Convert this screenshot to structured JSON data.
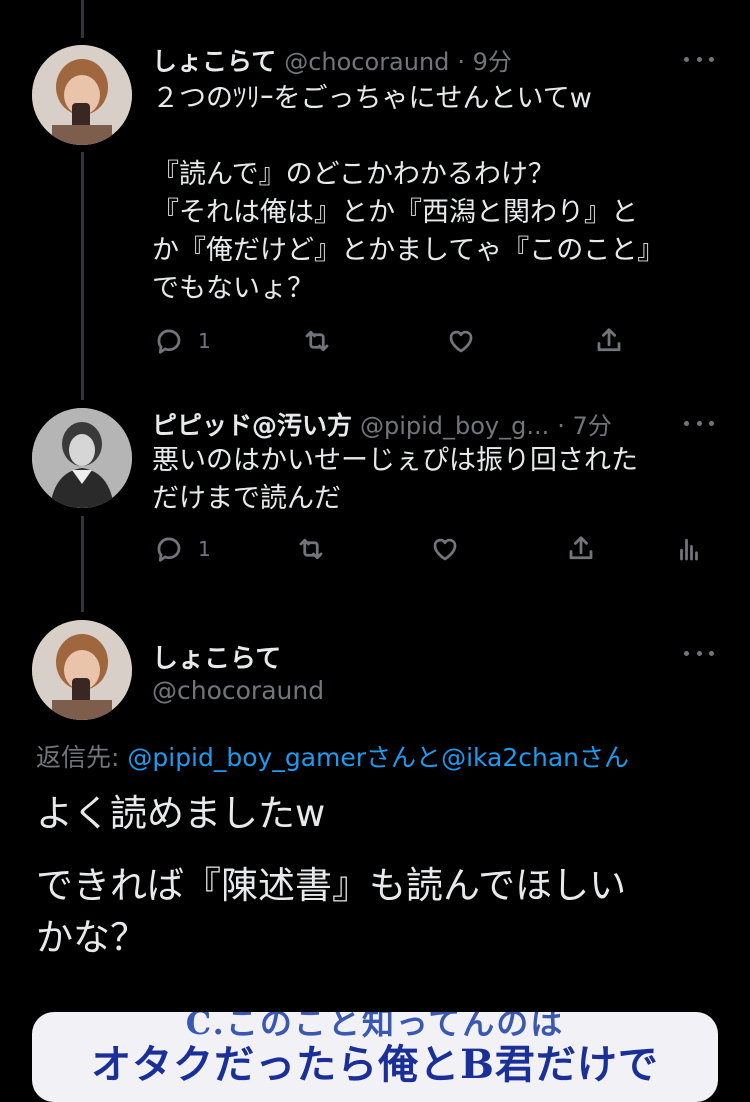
{
  "tweets": [
    {
      "name": "しょこらて",
      "handle": "@chocoraund",
      "time": "· 9分",
      "text": "２つのﾂﾘｰをごっちゃにせんといてw\n\n『読んで』のどこかわかるわけ？\n『それは俺は』とか『西潟と関わり』と\nか『俺だけど』とかましてゃ『このこと』\nでもないょ？",
      "reply_count": "1"
    },
    {
      "name": "ピピッド@汚い方",
      "handle": "@pipid_boy_g...",
      "time": "· 7分",
      "text": "悪いのはかいせーじぇぴは振り回された\nだけまで読んだ",
      "reply_count": "1"
    }
  ],
  "main": {
    "name": "しょこらて",
    "handle": "@chocoraund",
    "reply_prefix": "返信先: ",
    "reply_user1": "@pipid_boy_gamer",
    "reply_mid": "さんと",
    "reply_user2": "@ika2chan",
    "reply_suffix": "さん",
    "line1": "よく読めましたw",
    "line2": "できれば『陳述書』も読んでほしい",
    "line3": "かな？"
  },
  "media": {
    "caption_top": "C.このこと知ってんのは",
    "caption_main": "オタクだったら俺とB君だけで"
  },
  "colors": {
    "background": "#000000",
    "text": "#e7e9ea",
    "muted": "#71767b",
    "link": "#1d9bf0"
  },
  "icons": [
    "reply-icon",
    "retweet-icon",
    "like-icon",
    "share-icon",
    "analytics-icon",
    "more-icon"
  ]
}
